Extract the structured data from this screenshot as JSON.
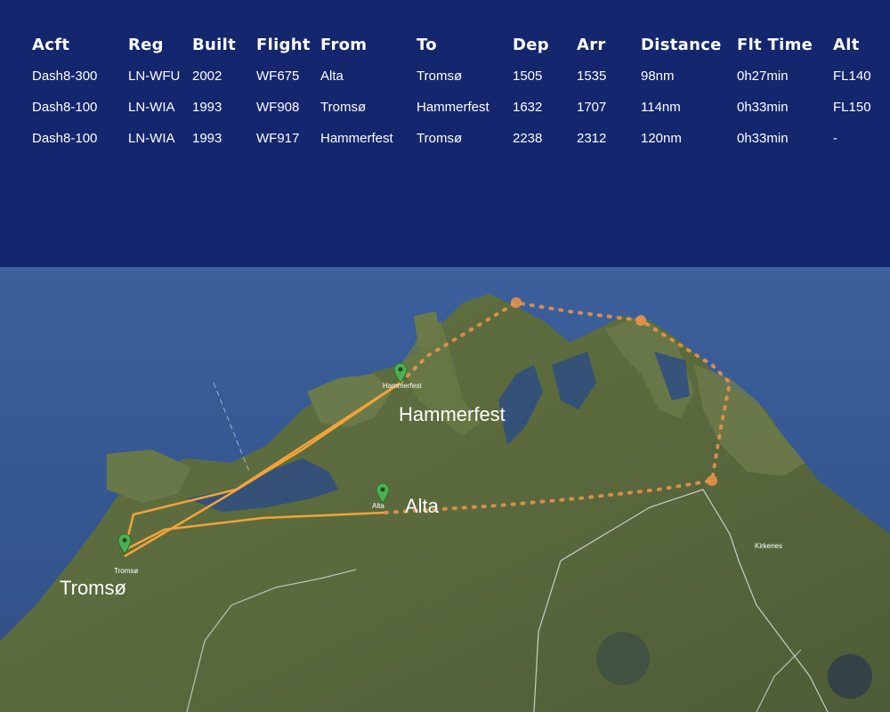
{
  "table": {
    "headers": [
      "Acft",
      "Reg",
      "Built",
      "Flight",
      "From",
      "To",
      "Dep",
      "Arr",
      "Distance",
      "Flt Time",
      "Alt"
    ],
    "rows": [
      [
        "Dash8-300",
        "LN-WFU",
        "2002",
        "WF675",
        "Alta",
        "Tromsø",
        "1505",
        "1535",
        "98nm",
        "0h27min",
        "FL140"
      ],
      [
        "Dash8-100",
        "LN-WIA",
        "1993",
        "WF908",
        "Tromsø",
        "Hammerfest",
        "1632",
        "1707",
        "114nm",
        "0h33min",
        "FL150"
      ],
      [
        "Dash8-100",
        "LN-WIA",
        "1993",
        "WF917",
        "Hammerfest",
        "Tromsø",
        "2238",
        "2312",
        "120nm",
        "0h33min",
        "-"
      ]
    ]
  },
  "map": {
    "cities": {
      "tromso": {
        "label": "Tromsø",
        "small_label": "Tromsø"
      },
      "alta": {
        "label": "Alta",
        "small_label": "Alta"
      },
      "hammerfest": {
        "label": "Hammerfest",
        "small_label": "Hammerfest"
      },
      "kirkenes": {
        "small_label": "Kirkenes"
      }
    },
    "colors": {
      "route": "#f2a33a",
      "dotted_route": "#e6924a",
      "marker": "#4caf50",
      "sea": "#3a5f9a",
      "land": "#5d6b3f"
    }
  }
}
